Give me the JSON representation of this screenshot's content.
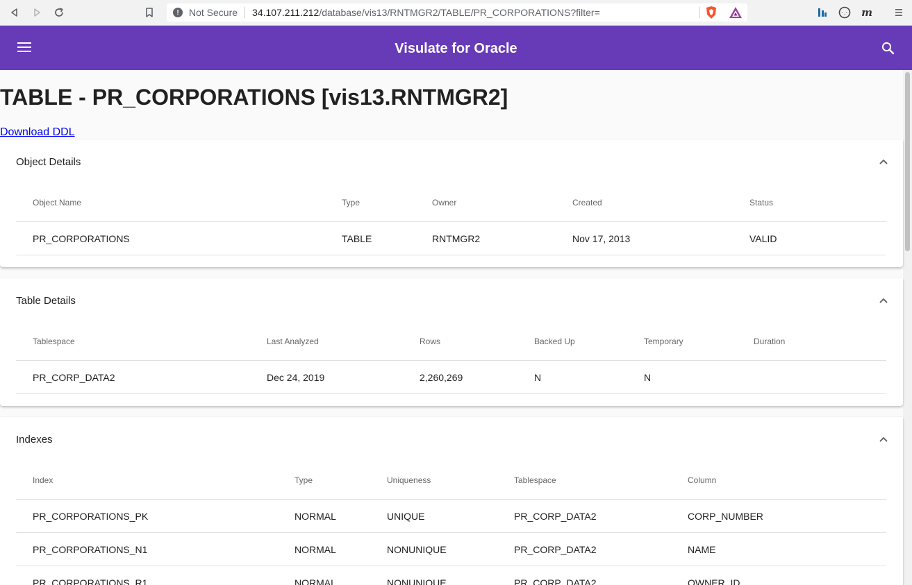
{
  "browser": {
    "security_label": "Not Secure",
    "url_host": "34.107.211.212",
    "url_path": "/database/vis13/RNTMGR2/TABLE/PR_CORPORATIONS?filter=",
    "icons": [
      "back-icon",
      "forward-icon",
      "reload-icon",
      "bookmark-icon",
      "brave-shield-icon",
      "brave-rewards-icon",
      "extension-icon",
      "extension-icon",
      "extension-icon",
      "browser-menu-icon"
    ]
  },
  "app": {
    "title": "Visulate for Oracle",
    "accent_color": "#673ab7"
  },
  "page": {
    "heading": "TABLE - PR_CORPORATIONS [vis13.RNTMGR2]",
    "download_link": "Download DDL"
  },
  "object_details": {
    "title": "Object Details",
    "headers": [
      "Object Name",
      "Type",
      "Owner",
      "Created",
      "Status"
    ],
    "rows": [
      [
        "PR_CORPORATIONS",
        "TABLE",
        "RNTMGR2",
        "Nov 17, 2013",
        "VALID"
      ]
    ]
  },
  "table_details": {
    "title": "Table Details",
    "headers": [
      "Tablespace",
      "Last Analyzed",
      "Rows",
      "Backed Up",
      "Temporary",
      "Duration"
    ],
    "rows": [
      [
        "PR_CORP_DATA2",
        "Dec 24, 2019",
        "2,260,269",
        "N",
        "N",
        ""
      ]
    ]
  },
  "indexes": {
    "title": "Indexes",
    "headers": [
      "Index",
      "Type",
      "Uniqueness",
      "Tablespace",
      "Column"
    ],
    "rows": [
      [
        "PR_CORPORATIONS_PK",
        "NORMAL",
        "UNIQUE",
        "PR_CORP_DATA2",
        "CORP_NUMBER"
      ],
      [
        "PR_CORPORATIONS_N1",
        "NORMAL",
        "NONUNIQUE",
        "PR_CORP_DATA2",
        "NAME"
      ],
      [
        "PR_CORPORATIONS_R1",
        "NORMAL",
        "NONUNIQUE",
        "PR_CORP_DATA2",
        "OWNER_ID"
      ]
    ]
  }
}
